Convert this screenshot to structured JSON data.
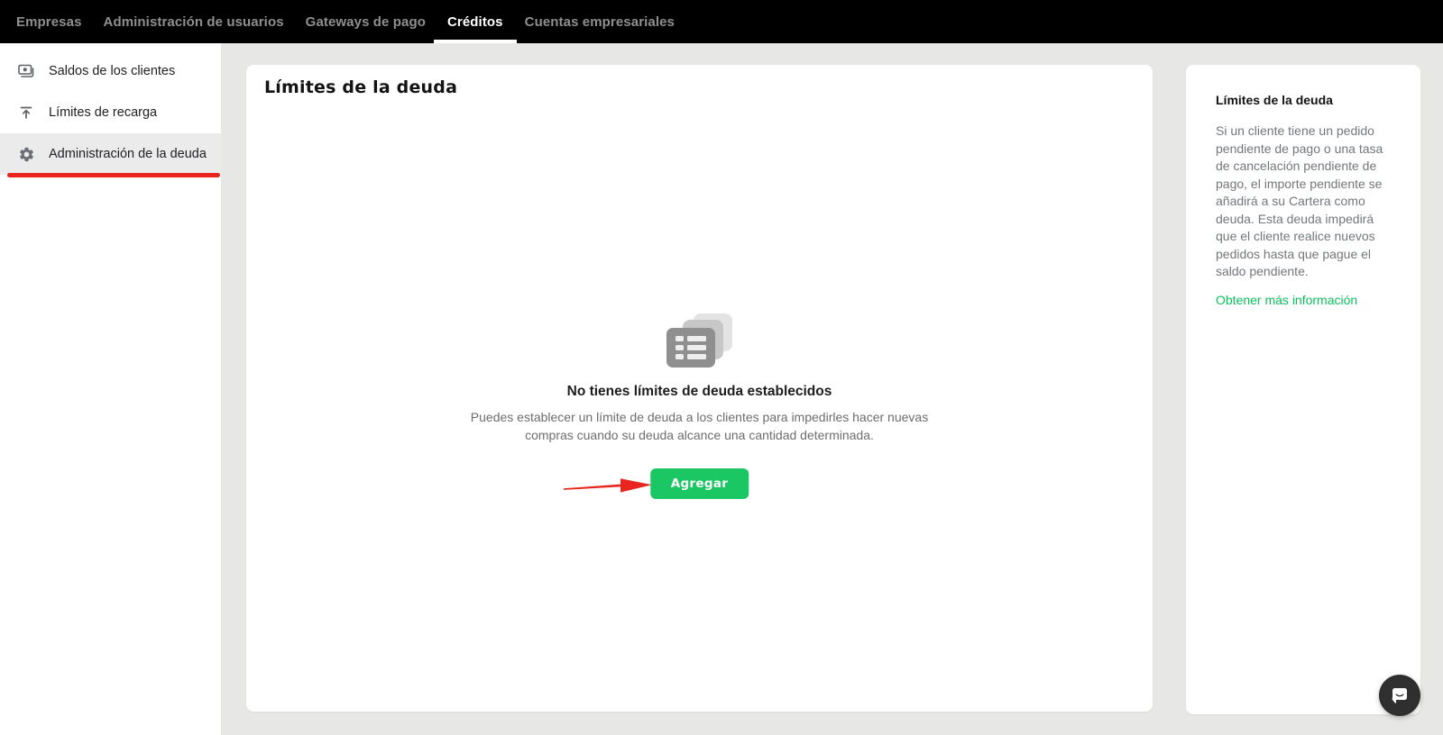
{
  "navbar": {
    "tabs": [
      {
        "label": "Empresas",
        "active": false
      },
      {
        "label": "Administración de usuarios",
        "active": false
      },
      {
        "label": "Gateways de pago",
        "active": false
      },
      {
        "label": "Créditos",
        "active": true
      },
      {
        "label": "Cuentas empresariales",
        "active": false
      }
    ]
  },
  "sidebar": {
    "items": [
      {
        "label": "Saldos de los clientes",
        "icon": "banknote-icon",
        "active": false
      },
      {
        "label": "Límites de recarga",
        "icon": "upload-limit-icon",
        "active": false
      },
      {
        "label": "Administración de la deuda",
        "icon": "gear-icon",
        "active": true,
        "annotated": true
      }
    ]
  },
  "main": {
    "title": "Límites de la deuda",
    "empty_state": {
      "icon": "stacked-list-icon",
      "title": "No tienes límites de deuda establecidos",
      "description": "Puedes establecer un límite de deuda a los clientes para impedirles hacer nuevas compras cuando su deuda alcance una cantidad determinada.",
      "button_label": "Agregar"
    }
  },
  "info_panel": {
    "title": "Límites de la deuda",
    "body": "Si un cliente tiene un pedido pendiente de pago o una tasa de cancelación pendiente de pago, el importe pendiente se añadirá a su Cartera como deuda. Esta deuda impedirá que el cliente realice nuevos pedidos hasta que pague el saldo pendiente.",
    "link_label": "Obtener más información"
  },
  "widgets": {
    "chat_icon": "chat-bubble-icon"
  },
  "annotations": {
    "sidebar_underline": {
      "color": "#e8251f",
      "target": "Administración de la deuda"
    },
    "arrow": {
      "color": "#e8251f",
      "target": "Agregar"
    }
  },
  "colors": {
    "navbar_bg": "#000000",
    "page_bg": "#e7e7e6",
    "accent_green": "#1bc763",
    "link_green": "#0cc05e",
    "annotation_red": "#e8251f",
    "active_item_bg": "#ebebeb"
  }
}
